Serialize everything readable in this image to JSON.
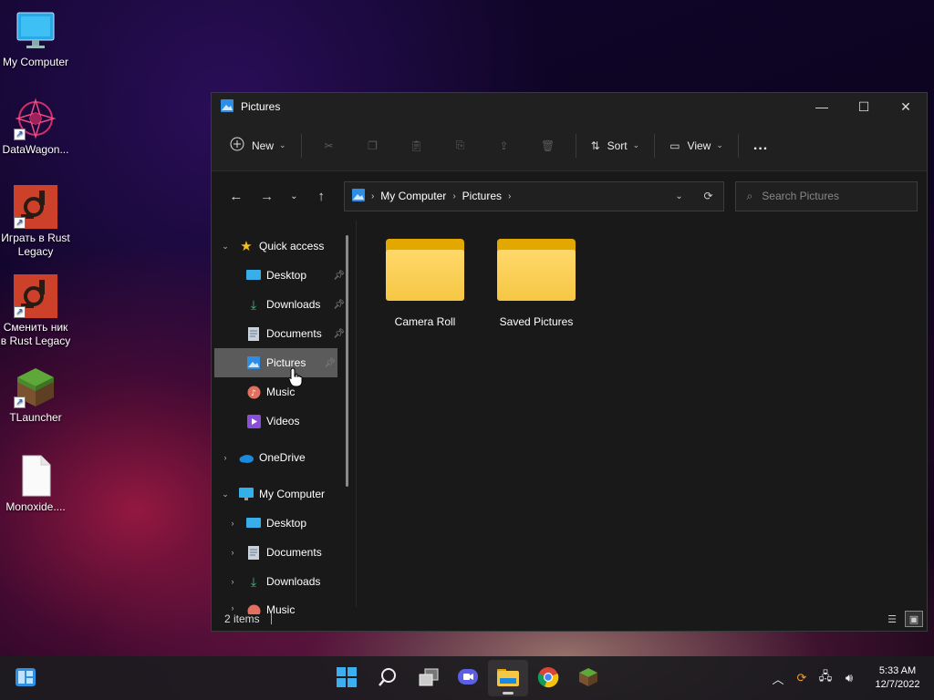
{
  "desktop": {
    "icons": [
      {
        "label": "My Computer",
        "icon": "monitor-icon"
      },
      {
        "label": "DataWagon...",
        "icon": "datawagon-icon"
      },
      {
        "label": "Играть в Rust Legacy",
        "icon": "rust-icon"
      },
      {
        "label": "Сменить ник в Rust Legacy",
        "icon": "rust-icon"
      },
      {
        "label": "TLauncher",
        "icon": "grass-block-icon"
      },
      {
        "label": "Monoxide....",
        "icon": "file-icon"
      }
    ]
  },
  "window": {
    "title": "Pictures",
    "toolbar": {
      "new_label": "New",
      "sort_label": "Sort",
      "view_label": "View",
      "more_label": "..."
    },
    "address": {
      "crumbs": [
        "My Computer",
        "Pictures"
      ]
    },
    "search": {
      "placeholder": "Search Pictures"
    },
    "sidebar": {
      "quick_access": "Quick access",
      "items": [
        {
          "label": "Desktop"
        },
        {
          "label": "Downloads"
        },
        {
          "label": "Documents"
        },
        {
          "label": "Pictures"
        },
        {
          "label": "Music"
        },
        {
          "label": "Videos"
        }
      ],
      "onedrive": "OneDrive",
      "my_computer": "My Computer",
      "computer_items": [
        {
          "label": "Desktop"
        },
        {
          "label": "Documents"
        },
        {
          "label": "Downloads"
        },
        {
          "label": "Music"
        }
      ]
    },
    "folders": [
      {
        "label": "Camera Roll"
      },
      {
        "label": "Saved Pictures"
      }
    ],
    "status": {
      "count": "2 items"
    }
  },
  "taskbar": {
    "clock_time": "5:33 AM",
    "clock_date": "12/7/2022"
  }
}
